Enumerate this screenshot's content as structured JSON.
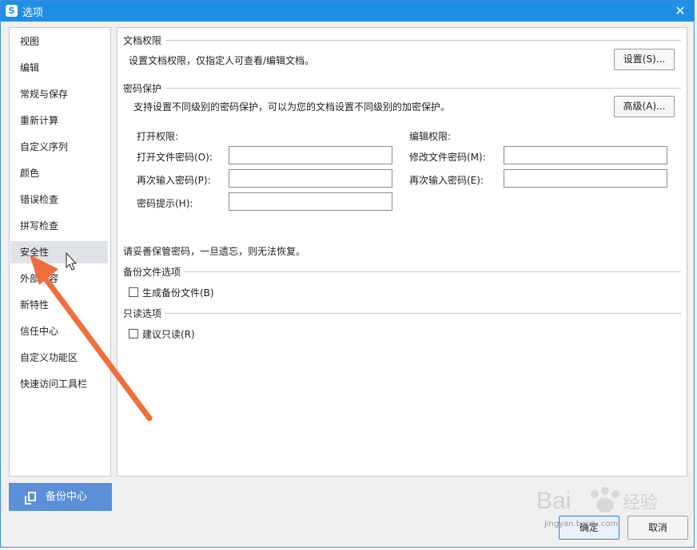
{
  "window": {
    "title": "选项",
    "logo": "S",
    "close_glyph": "✕"
  },
  "sidebar": {
    "items": [
      {
        "label": "视图"
      },
      {
        "label": "编辑"
      },
      {
        "label": "常规与保存"
      },
      {
        "label": "重新计算"
      },
      {
        "label": "自定义序列"
      },
      {
        "label": "颜色"
      },
      {
        "label": "错误检查"
      },
      {
        "label": "拼写检查"
      },
      {
        "label": "安全性",
        "selected": true
      },
      {
        "label": "外部内容"
      },
      {
        "label": "新特性"
      },
      {
        "label": "信任中心"
      },
      {
        "label": "自定义功能区"
      },
      {
        "label": "快速访问工具栏"
      }
    ],
    "backup_label": "备份中心"
  },
  "doc_rights": {
    "title": "文档权限",
    "desc": "设置文档权限，仅指定人可查看/编辑文档。",
    "button": "设置(S)..."
  },
  "password": {
    "title": "密码保护",
    "desc": "支持设置不同级别的密码保护，可以为您的文档设置不同级别的加密保护。",
    "button": "高级(A)...",
    "open_heading": "打开权限:",
    "open_password": "打开文件密码(O):",
    "open_confirm": "再次输入密码(P):",
    "hint": "密码提示(H):",
    "edit_heading": "编辑权限:",
    "edit_password": "修改文件密码(M):",
    "edit_confirm": "再次输入密码(E):",
    "open_password_value": "",
    "open_confirm_value": "",
    "hint_value": "",
    "edit_password_value": "",
    "edit_confirm_value": "",
    "warning": "请妥善保管密码，一旦遗忘，则无法恢复。"
  },
  "backup": {
    "title": "备份文件选项",
    "checkbox_label": "生成备份文件(B)",
    "checked": false
  },
  "readonly": {
    "title": "只读选项",
    "checkbox_label": "建议只读(R)",
    "checked": false
  },
  "footer": {
    "ok_label": "确定",
    "cancel_label": "取消"
  },
  "watermark": {
    "brand": "Bai",
    "brand_suffix": "经验",
    "url": "jingyan.baidu.com"
  },
  "colors": {
    "titlebar": "#1f8fe6",
    "backup_button": "#5b8fd8",
    "arrow": "#f26d3d"
  }
}
